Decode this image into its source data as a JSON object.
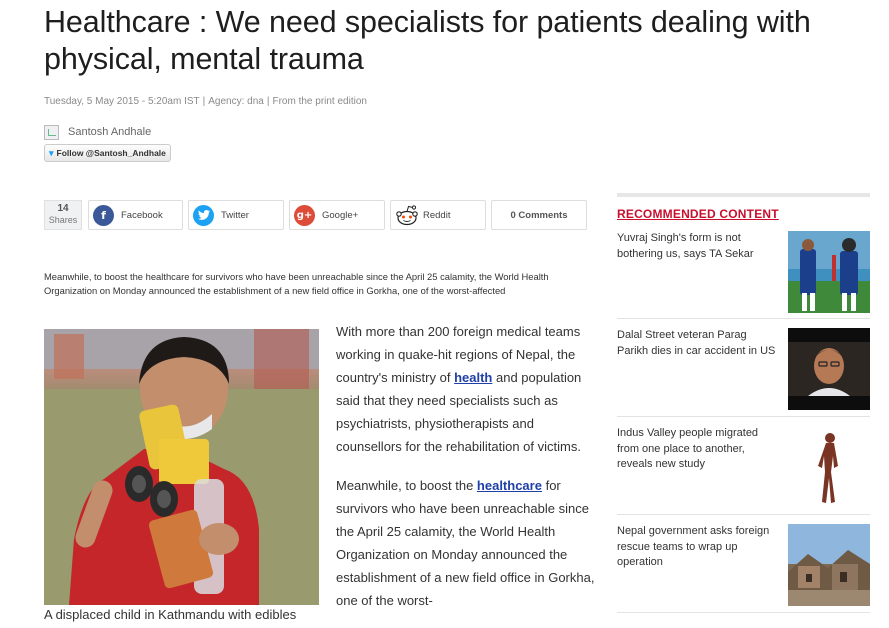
{
  "article": {
    "headline": "Healthcare : We need specialists for patients dealing with physical, mental trauma",
    "date": "Tuesday, 5 May 2015 - 5:20am IST",
    "agency": "Agency: dna",
    "edition": "From the print edition",
    "author": "Santosh Andhale",
    "follow_label": "Follow @Santosh_Andhale"
  },
  "share": {
    "count": "14",
    "count_label": "Shares",
    "buttons": [
      {
        "label": "Facebook",
        "icon": "facebook-icon",
        "color": "#3b5998"
      },
      {
        "label": "Twitter",
        "icon": "twitter-icon",
        "color": "#1da1f2"
      },
      {
        "label": "Google+",
        "icon": "google-plus-icon",
        "color": "#dd4b39"
      },
      {
        "label": "Reddit",
        "icon": "reddit-icon",
        "color": "#ff4500"
      }
    ],
    "comments_label": "0 Comments"
  },
  "summary": "Meanwhile, to boost the healthcare for survivors who have been unreachable since the April 25 calamity, the World Health Organization on Monday announced the establishment of a new field office in Gorkha, one of the worst-affected",
  "photo_caption": "A displaced child in Kathmandu with edibles",
  "body": {
    "p1_a": "With more than 200 foreign medical teams working in quake-hit regions of Nepal, the country's ministry of ",
    "p1_link": "health",
    "p1_b": " and population said that they need specialists such as psychiatrists, physiotherapists and counsellors for the rehabilitation of victims.",
    "p2_a": "Meanwhile, to boost the ",
    "p2_link": "healthcare",
    "p2_b": " for survivors who have been unreachable since the April 25 calamity, the World Health Organization on Monday announced the establishment of a new field office in Gorkha, one of the worst-"
  },
  "sidebar": {
    "title": "RECOMMENDED CONTENT",
    "accent_color": "#c8102e",
    "items": [
      {
        "title": "Yuvraj Singh's form is not bothering us, says TA Sekar"
      },
      {
        "title": "Dalal Street veteran Parag Parikh dies in car accident in US"
      },
      {
        "title": "Indus Valley people migrated from one place to another, reveals new study"
      },
      {
        "title": "Nepal government asks foreign rescue teams to wrap up operation"
      }
    ]
  }
}
